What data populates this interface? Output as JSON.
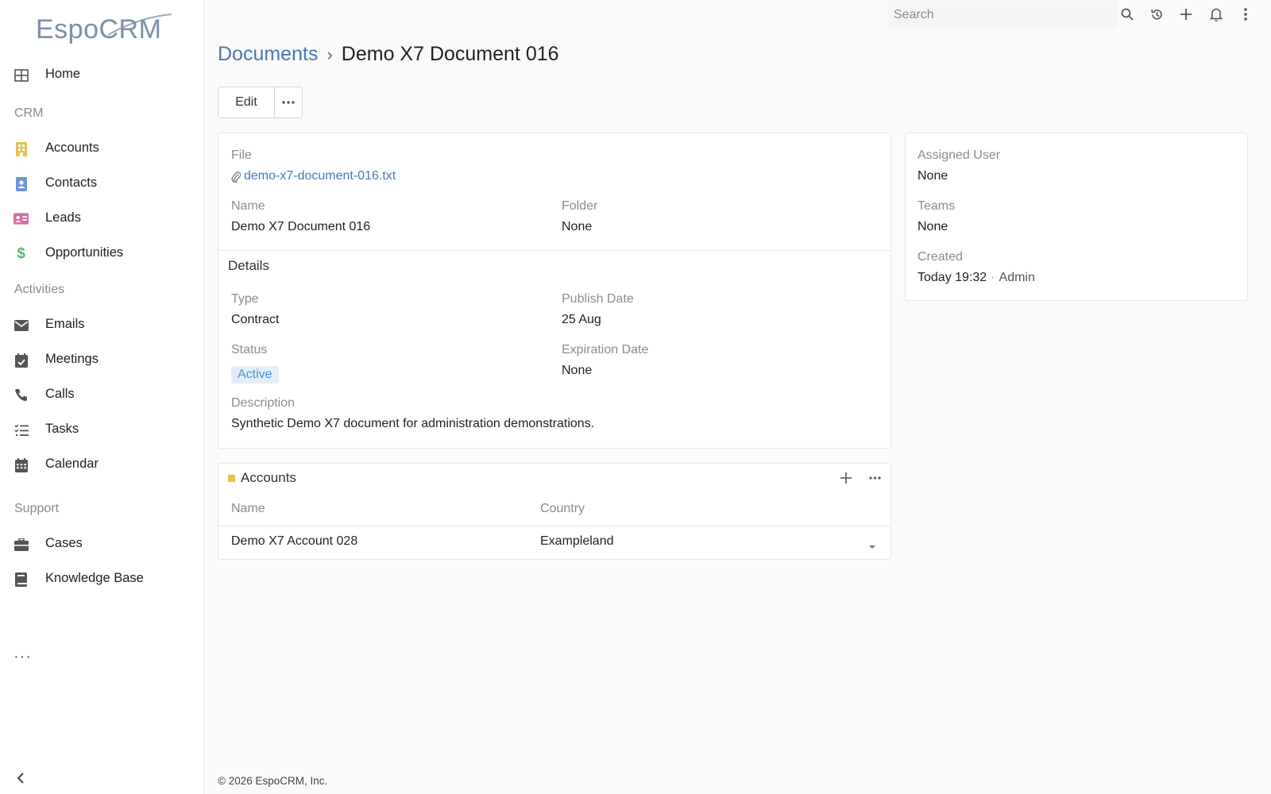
{
  "app": {
    "logo_text": "EspoCRM"
  },
  "sidebar": {
    "home": "Home",
    "groups": {
      "crm": "CRM",
      "activities": "Activities",
      "support": "Support"
    },
    "items": {
      "accounts": "Accounts",
      "contacts": "Contacts",
      "leads": "Leads",
      "opportunities": "Opportunities",
      "emails": "Emails",
      "meetings": "Meetings",
      "calls": "Calls",
      "tasks": "Tasks",
      "calendar": "Calendar",
      "cases": "Cases",
      "knowledge_base": "Knowledge Base"
    },
    "more": "···"
  },
  "topbar": {
    "search_placeholder": "Search"
  },
  "header": {
    "breadcrumb_parent": "Documents",
    "breadcrumb_sep": "›",
    "title": "Demo X7 Document 016"
  },
  "actions": {
    "edit_label": "Edit",
    "more_label": "···"
  },
  "main_panel": {
    "file_label": "File",
    "file_value": "demo-x7-document-016.txt",
    "name_label": "Name",
    "name_value": "Demo X7 Document 016",
    "folder_label": "Folder",
    "folder_value": "None",
    "details_title": "Details",
    "type_label": "Type",
    "type_value": "Contract",
    "publish_date_label": "Publish Date",
    "publish_date_value": "25 Aug",
    "status_label": "Status",
    "status_value": "Active",
    "expiration_date_label": "Expiration Date",
    "expiration_date_value": "None",
    "description_label": "Description",
    "description_value": "Synthetic Demo X7 document for administration demonstrations."
  },
  "side_panel": {
    "assigned_user_label": "Assigned User",
    "assigned_user_value": "None",
    "teams_label": "Teams",
    "teams_value": "None",
    "created_label": "Created",
    "created_time": "Today 19:32",
    "created_sep": "·",
    "created_by": "Admin"
  },
  "accounts_panel": {
    "title": "Accounts",
    "columns": [
      "Name",
      "Country"
    ],
    "rows": [
      {
        "name": "Demo X7 Account 028",
        "country": "Exampleland"
      }
    ]
  },
  "footer": {
    "text": "© 2026 EspoCRM, Inc."
  },
  "colors": {
    "link": "#4a77b3",
    "accounts_icon": "#e8c34a",
    "contacts_icon": "#6e93d6",
    "leads_icon": "#d36fa6",
    "opportunities_icon": "#5bb66b",
    "status_badge_bg": "#e3eef9",
    "status_badge_text": "#4a8fd6"
  }
}
